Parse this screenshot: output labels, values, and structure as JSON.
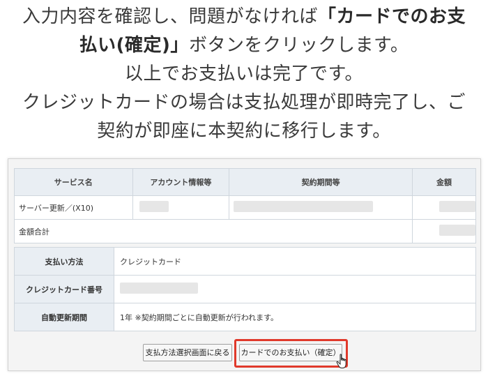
{
  "instructions": {
    "line1_pre": "入力内容を確認し、問題がなければ",
    "line1_bold": "「カードでのお支",
    "line2_bold": "払い(確定)」",
    "line2_post": "ボタンをクリックします。",
    "line3": "以上でお支払いは完了です。",
    "line4": "クレジットカードの場合は支払処理が即時完了し、ご",
    "line5": "契約が即座に本契約に移行します。"
  },
  "service_table": {
    "headers": [
      "サービス名",
      "アカウント情報等",
      "契約期間等",
      "金額"
    ],
    "row_service": "サーバー更新／(X10)",
    "row_total": "金額合計"
  },
  "payment_table": {
    "method_label": "支払い方法",
    "method_value": "クレジットカード",
    "card_label": "クレジットカード番号",
    "renew_label": "自動更新期間",
    "renew_value": "1年 ※契約期間ごとに自動更新が行われます。"
  },
  "buttons": {
    "back": "支払方法選択画面に戻る",
    "confirm": "カードでのお支払い（確定）"
  },
  "colors": {
    "highlight": "#e0392b",
    "header_bg": "#e9eef3"
  }
}
